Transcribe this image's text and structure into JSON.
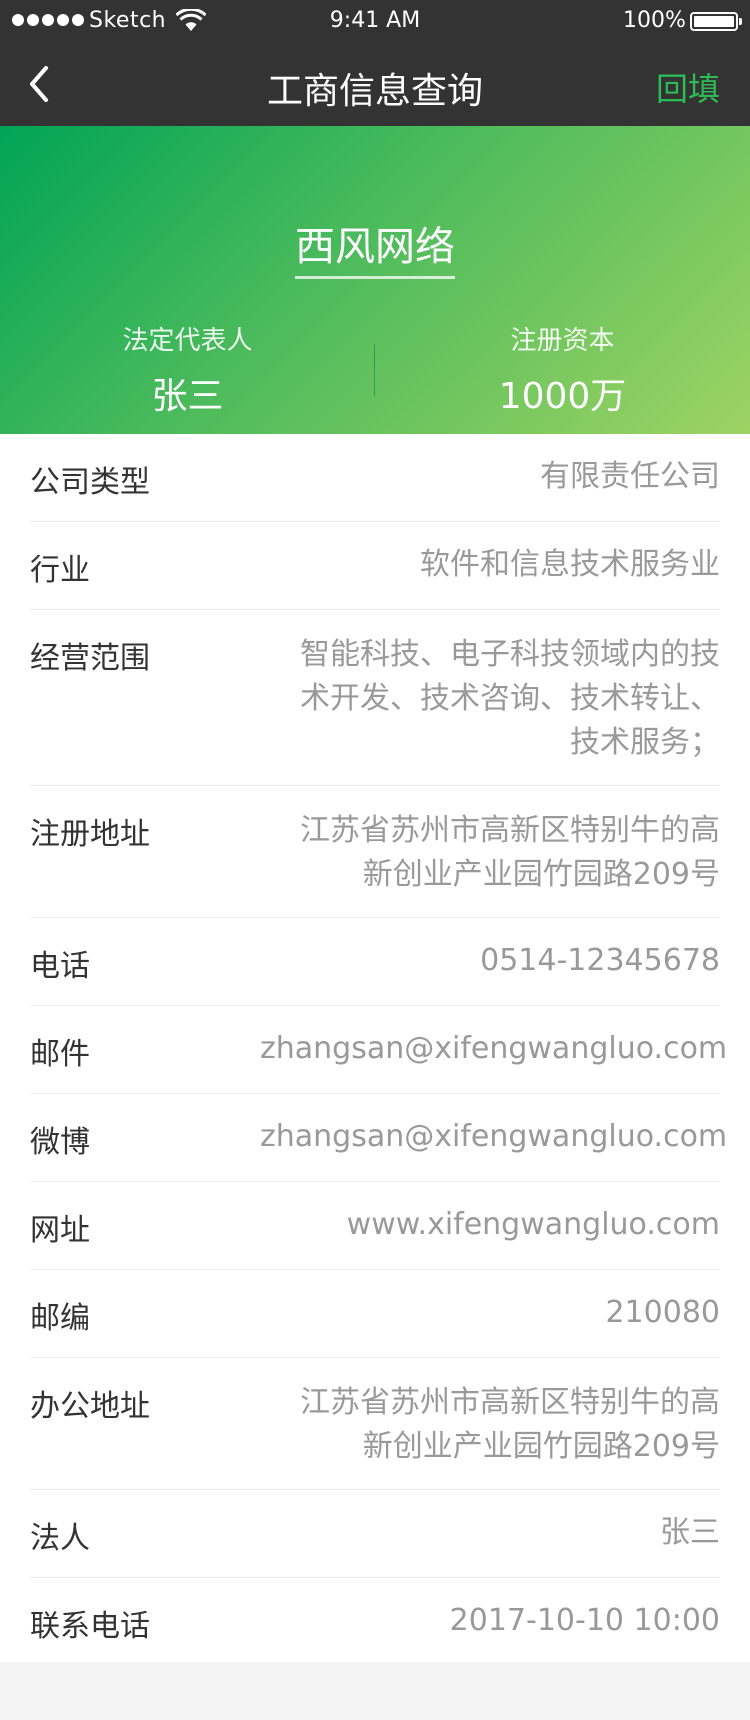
{
  "status_bar": {
    "carrier": "Sketch",
    "time": "9:41 AM",
    "battery_pct": "100%"
  },
  "nav": {
    "title": "工商信息查询",
    "action": "回填"
  },
  "banner": {
    "company_name": "西风网络",
    "legal_rep_label": "法定代表人",
    "legal_rep_value": "张三",
    "capital_label": "注册资本",
    "capital_value": "1000万"
  },
  "rows": [
    {
      "label": "公司类型",
      "value": "有限责任公司"
    },
    {
      "label": "行业",
      "value": "软件和信息技术服务业"
    },
    {
      "label": "经营范围",
      "value_lines": [
        "智能科技、电子科技领域内的技",
        "术开发、技术咨询、技术转让、",
        "技术服务；"
      ]
    },
    {
      "label": "注册地址",
      "value_lines": [
        "江苏省苏州市高新区特别牛的高",
        "新创业产业园竹园路209号"
      ]
    },
    {
      "label": "电话",
      "value": "0514-12345678"
    },
    {
      "label": "邮件",
      "value": "zhangsan@xifengwangluo.com"
    },
    {
      "label": "微博",
      "value": "zhangsan@xifengwangluo.com"
    },
    {
      "label": "网址",
      "value": "www.xifengwangluo.com"
    },
    {
      "label": "邮编",
      "value": "210080"
    },
    {
      "label": "办公地址",
      "value_lines": [
        "江苏省苏州市高新区特别牛的高",
        "新创业产业园竹园路209号"
      ]
    },
    {
      "label": "法人",
      "value": "张三"
    },
    {
      "label": "联系电话",
      "value": "2017-10-10 10:00"
    }
  ],
  "colors": {
    "header_bg": "#333333",
    "accent": "#2cbb54",
    "banner_start": "#00a456",
    "banner_end": "#9ed363"
  }
}
